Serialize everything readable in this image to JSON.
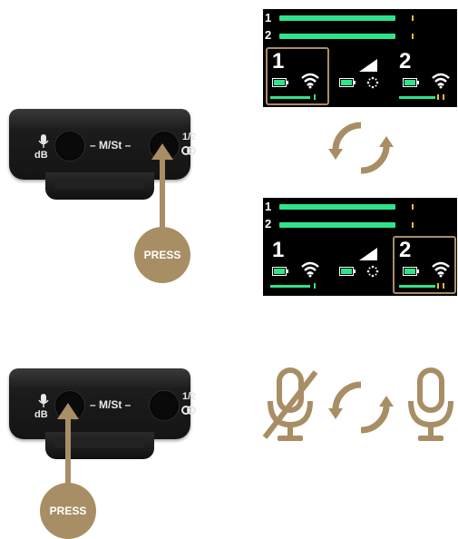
{
  "device": {
    "label_mode": "– M/St –",
    "label_db": "dB",
    "label_pair": "1/2",
    "mic_icon": "mic-icon",
    "link_icon": "link-icon"
  },
  "press_label": "PRESS",
  "screen": {
    "row1": "1",
    "row2": "2",
    "ch1": "1",
    "ch2": "2"
  },
  "colors": {
    "accent": "#a88e64",
    "meter": "#2fe38a",
    "peak": "#f0c020"
  }
}
